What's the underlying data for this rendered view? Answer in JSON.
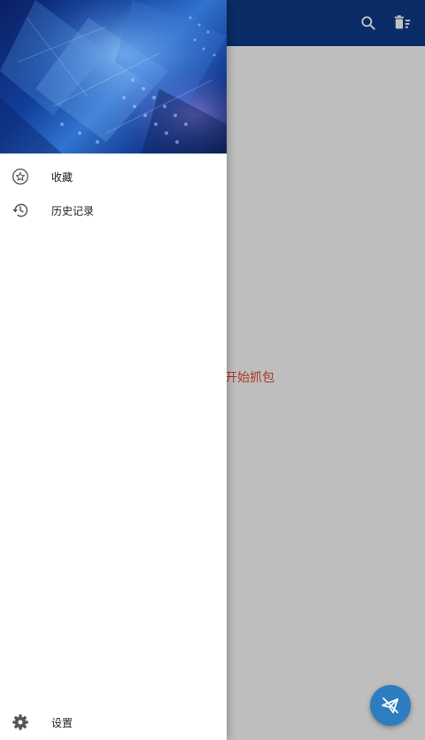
{
  "appbar": {
    "actions": [
      {
        "icon": "search-icon"
      },
      {
        "icon": "delete-sweep-icon"
      }
    ]
  },
  "content": {
    "empty_hint": "点击下方按钮开始抓包"
  },
  "drawer": {
    "items": [
      {
        "icon": "star-icon",
        "label": "收藏"
      },
      {
        "icon": "history-icon",
        "label": "历史记录"
      }
    ],
    "footer": {
      "icon": "gear-icon",
      "label": "设置"
    }
  },
  "fab": {
    "icon": "send-off-icon"
  },
  "colors": {
    "appbar": "#0d3a86",
    "accent": "#2d7ec1",
    "hint": "#e2492f"
  }
}
